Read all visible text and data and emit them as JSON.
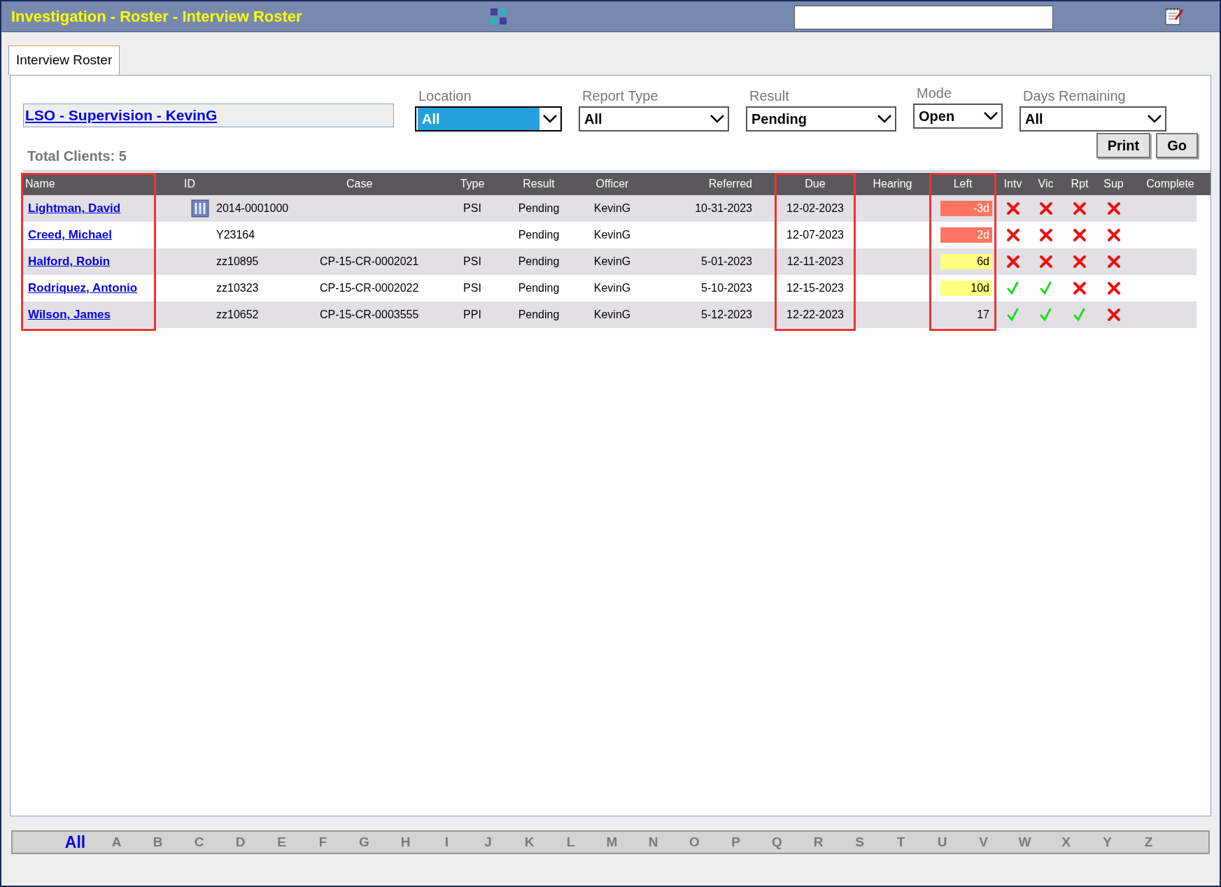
{
  "window": {
    "title": "Investigation - Roster - Interview Roster"
  },
  "tabs": [
    {
      "label": "Interview Roster",
      "selected": true
    }
  ],
  "supervisor_link": "LSO - Supervision - KevinG",
  "filters": [
    {
      "label": "Location",
      "value": "All",
      "focused": true
    },
    {
      "label": "Report Type",
      "value": "All",
      "focused": false
    },
    {
      "label": "Result",
      "value": "Pending",
      "focused": false
    },
    {
      "label": "Mode",
      "value": "Open",
      "focused": false
    },
    {
      "label": "Days Remaining",
      "value": "All",
      "focused": false
    }
  ],
  "total_clients": "Total Clients: 5",
  "buttons": [
    "Print",
    "Go"
  ],
  "table": {
    "columns": [
      {
        "label": "Name",
        "highlighted": true
      },
      {
        "label": "ID",
        "highlighted": false
      },
      {
        "label": "Case",
        "highlighted": false
      },
      {
        "label": "Type",
        "highlighted": false
      },
      {
        "label": "Result",
        "highlighted": false
      },
      {
        "label": "Officer",
        "highlighted": false
      },
      {
        "label": "Referred",
        "highlighted": false
      },
      {
        "label": "Due",
        "highlighted": true
      },
      {
        "label": "Hearing",
        "highlighted": false
      },
      {
        "label": "Left",
        "highlighted": true
      },
      {
        "label": "Intv",
        "highlighted": false
      },
      {
        "label": "Vic",
        "highlighted": false
      },
      {
        "label": "Rpt",
        "highlighted": false
      },
      {
        "label": "Sup",
        "highlighted": false
      },
      {
        "label": "Complete",
        "highlighted": false
      }
    ],
    "rows": [
      {
        "name": "Lightman, David",
        "has_icon": true,
        "id": "2014-0001000",
        "type": "PSI",
        "result": "Pending",
        "officer": "KevinG",
        "referred": "10-31-2023",
        "due": "12-02-2023",
        "left": {
          "text": "-3d",
          "color": "#ff7460",
          "light_text": true
        },
        "intv": false,
        "vic": false,
        "rpt": false,
        "sup": false
      },
      {
        "name": "Creed, Michael",
        "has_icon": false,
        "id": "Y23164",
        "result": "Pending",
        "officer": "KevinG",
        "due": "12-07-2023",
        "left": {
          "text": "2d",
          "color": "#ff7460",
          "light_text": true
        },
        "intv": false,
        "vic": false,
        "rpt": false,
        "sup": false
      },
      {
        "name": "Halford, Robin",
        "has_icon": false,
        "id": "zz10895",
        "case": "CP-15-CR-0002021",
        "type": "PSI",
        "result": "Pending",
        "officer": "KevinG",
        "referred": "5-01-2023",
        "due": "12-11-2023",
        "left": {
          "text": "6d",
          "color": "#ffff80",
          "light_text": false
        },
        "intv": false,
        "vic": false,
        "rpt": false,
        "sup": false
      },
      {
        "name": "Rodriquez, Antonio",
        "has_icon": false,
        "id": "zz10323",
        "case": "CP-15-CR-0002022",
        "type": "PSI",
        "result": "Pending",
        "officer": "KevinG",
        "referred": "5-10-2023",
        "due": "12-15-2023",
        "left": {
          "text": "10d",
          "color": "#ffff80",
          "light_text": false
        },
        "intv": true,
        "vic": true,
        "rpt": false,
        "sup": false
      },
      {
        "name": "Wilson, James",
        "has_icon": false,
        "id": "zz10652",
        "case": "CP-15-CR-0003555",
        "type": "PPI",
        "result": "Pending",
        "officer": "KevinG",
        "referred": "5-12-2023",
        "due": "12-22-2023",
        "left": {
          "text": "17",
          "light_text": false
        },
        "intv": true,
        "vic": true,
        "rpt": true,
        "sup": false
      }
    ]
  },
  "alphabet": [
    {
      "label": "All",
      "selected": true
    },
    {
      "label": "A",
      "selected": false
    },
    {
      "label": "B",
      "selected": false
    },
    {
      "label": "C",
      "selected": false
    },
    {
      "label": "D",
      "selected": false
    },
    {
      "label": "E",
      "selected": false
    },
    {
      "label": "F",
      "selected": false
    },
    {
      "label": "G",
      "selected": false
    },
    {
      "label": "H",
      "selected": false
    },
    {
      "label": "I",
      "selected": false
    },
    {
      "label": "J",
      "selected": false
    },
    {
      "label": "K",
      "selected": false
    },
    {
      "label": "L",
      "selected": false
    },
    {
      "label": "M",
      "selected": false
    },
    {
      "label": "N",
      "selected": false
    },
    {
      "label": "O",
      "selected": false
    },
    {
      "label": "P",
      "selected": false
    },
    {
      "label": "Q",
      "selected": false
    },
    {
      "label": "R",
      "selected": false
    },
    {
      "label": "S",
      "selected": false
    },
    {
      "label": "T",
      "selected": false
    },
    {
      "label": "U",
      "selected": false
    },
    {
      "label": "V",
      "selected": false
    },
    {
      "label": "W",
      "selected": false
    },
    {
      "label": "X",
      "selected": false
    },
    {
      "label": "Y",
      "selected": false
    },
    {
      "label": "Z",
      "selected": false
    }
  ]
}
